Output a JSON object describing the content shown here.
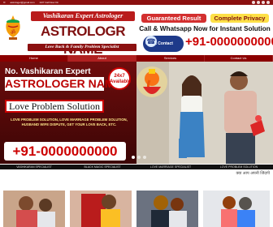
{
  "topbar": {
    "email": "astrologer@gmail.com",
    "hours": "24/7 Call Now On"
  },
  "header": {
    "tagline": "Vashikaran Expert Astrologer",
    "brand": "ASTROLOGR NAME",
    "subtag": "Love Back & Family Problem Specialist",
    "badge_guaranteed": "Guaranteed Result",
    "badge_privacy": "Complete Privacy",
    "call_line": "Call & Whatsapp Now for Instant Solution",
    "quick_contact": "Quick Contact",
    "phone": "+91-0000000000"
  },
  "nav": {
    "items": [
      {
        "label": "Home"
      },
      {
        "label": "About"
      },
      {
        "label": "Services"
      },
      {
        "label": "Contact Us"
      }
    ]
  },
  "hero": {
    "kicker": "No. Vashikaran Expert",
    "name": "ASTROLOGER NAME",
    "availability": "24x7 Available",
    "headline": "Love Problem Solution",
    "desc": "LOVE PROBLEM SOLUTION, LOVE MARRIAGE PROBLEM SOLUTION, HUSBAND WIFE DISPUTE, GET YOUR LOVE BACK, ETC.",
    "phone": "+91-0000000000"
  },
  "tiles": [
    {
      "label": "VASHIKARAN SPECIALIST"
    },
    {
      "label": "BLACK MAGIC SPECIALIST"
    },
    {
      "label": "LOVE MARRIAGE SPECIALIST"
    },
    {
      "label": "LOVE PROBLEM SOLUTION"
    }
  ],
  "hindi_text": "क्या आप अपनी जिंदगी",
  "colors": {
    "maroon": "#8b1010",
    "red": "#c00000",
    "gold": "#fde047",
    "navy": "#1e3a8a"
  }
}
